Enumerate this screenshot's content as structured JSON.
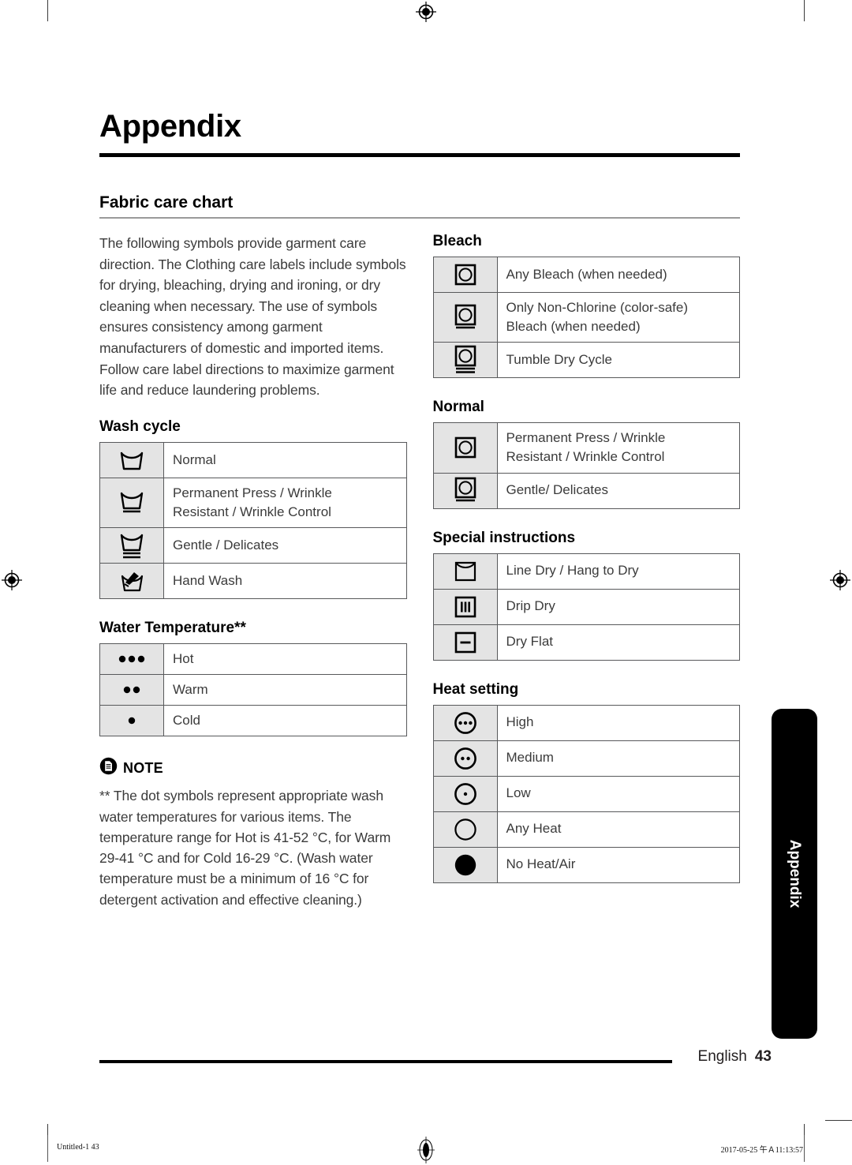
{
  "page": {
    "chapter_title": "Appendix",
    "section_title": "Fabric care chart",
    "intro": "The following symbols provide garment care direction. The Clothing care labels include symbols for drying, bleaching, drying and ironing, or dry cleaning when necessary. The use of symbols ensures consistency among garment manufacturers of domestic and imported items. Follow care label directions to maximize garment life and reduce laundering problems.",
    "side_tab": "Appendix",
    "footer_language": "English",
    "footer_page": "43"
  },
  "wash_cycle": {
    "heading": "Wash cycle",
    "rows": [
      {
        "icon": "washtub-icon",
        "label_line1": "Normal",
        "label_line2": ""
      },
      {
        "icon": "washtub-one-bar-icon",
        "label_line1": "Permanent Press / Wrinkle",
        "label_line2": "Resistant / Wrinkle Control"
      },
      {
        "icon": "washtub-two-bar-icon",
        "label_line1": "Gentle / Delicates",
        "label_line2": ""
      },
      {
        "icon": "hand-wash-icon",
        "label_line1": "Hand Wash",
        "label_line2": ""
      }
    ]
  },
  "water_temperature": {
    "heading": "Water Temperature**",
    "rows": [
      {
        "icon": "three-dots-icon",
        "label_line1": "Hot",
        "label_line2": ""
      },
      {
        "icon": "two-dots-icon",
        "label_line1": "Warm",
        "label_line2": ""
      },
      {
        "icon": "one-dot-icon",
        "label_line1": "Cold",
        "label_line2": ""
      }
    ]
  },
  "note": {
    "label": "NOTE",
    "icon": "note-document-icon",
    "body": "** The dot symbols represent appropriate wash water temperatures for various items. The temperature range for Hot is 41-52 °C, for Warm 29-41 °C and for Cold 16-29 °C. (Wash water temperature must be a minimum of 16 °C for detergent activation and effective cleaning.)"
  },
  "bleach": {
    "heading": "Bleach",
    "rows": [
      {
        "icon": "square-circle-icon",
        "label_line1": "Any Bleach (when needed)",
        "label_line2": ""
      },
      {
        "icon": "square-circle-one-bar-icon",
        "label_line1": "Only Non-Chlorine (color-safe)",
        "label_line2": "Bleach (when needed)"
      },
      {
        "icon": "square-circle-two-bar-icon",
        "label_line1": "Tumble Dry Cycle",
        "label_line2": ""
      }
    ]
  },
  "normal": {
    "heading": "Normal",
    "rows": [
      {
        "icon": "square-circle-icon",
        "label_line1": "Permanent Press / Wrinkle",
        "label_line2": "Resistant / Wrinkle Control"
      },
      {
        "icon": "square-circle-one-bar-icon",
        "label_line1": "Gentle/ Delicates",
        "label_line2": ""
      }
    ]
  },
  "special_instructions": {
    "heading": "Special instructions",
    "rows": [
      {
        "icon": "line-dry-icon",
        "label_line1": "Line Dry / Hang to Dry",
        "label_line2": ""
      },
      {
        "icon": "drip-dry-icon",
        "label_line1": "Drip Dry",
        "label_line2": ""
      },
      {
        "icon": "dry-flat-icon",
        "label_line1": "Dry Flat",
        "label_line2": ""
      }
    ]
  },
  "heat_setting": {
    "heading": "Heat setting",
    "rows": [
      {
        "icon": "circle-three-dots-icon",
        "label_line1": "High",
        "label_line2": ""
      },
      {
        "icon": "circle-two-dots-icon",
        "label_line1": "Medium",
        "label_line2": ""
      },
      {
        "icon": "circle-one-dot-icon",
        "label_line1": "Low",
        "label_line2": ""
      },
      {
        "icon": "circle-empty-icon",
        "label_line1": "Any Heat",
        "label_line2": ""
      },
      {
        "icon": "circle-filled-icon",
        "label_line1": "No Heat/Air",
        "label_line2": ""
      }
    ]
  },
  "print_strip": {
    "left": "Untitled-1   43",
    "right": "2017-05-25   午Ａ11:13:57"
  },
  "colors": {
    "symbol_cell_bg": "#e4e4e4",
    "table_border": "#58595b",
    "rule": "#000000",
    "body_text": "#3b3b3b"
  }
}
